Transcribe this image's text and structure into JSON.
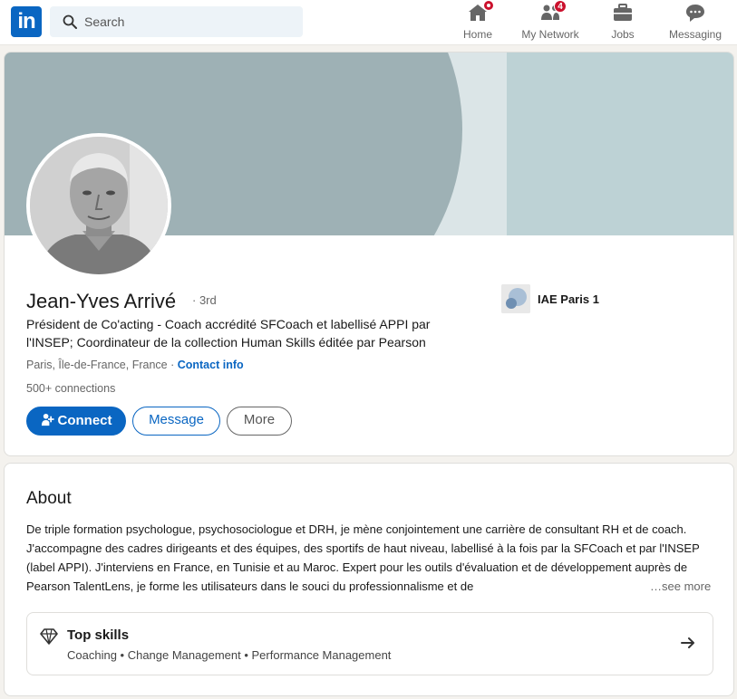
{
  "nav": {
    "logo_text": "in",
    "search_placeholder": "Search",
    "items": [
      {
        "label": "Home",
        "icon": "home-icon",
        "badge": ""
      },
      {
        "label": "My Network",
        "icon": "network-icon",
        "badge": "4"
      },
      {
        "label": "Jobs",
        "icon": "briefcase-icon",
        "badge": ""
      },
      {
        "label": "Messaging",
        "icon": "chat-icon",
        "badge": ""
      }
    ]
  },
  "profile": {
    "name": "Jean-Yves Arrivé",
    "degree": "· 3rd",
    "headline": "Président de Co'acting - Coach accrédité SFCoach et labellisé APPI par l'INSEP; Coordinateur de la collection Human Skills éditée par Pearson",
    "location": "Paris, Île-de-France, France",
    "location_sep": " · ",
    "contact_info": "Contact info",
    "connections": "500+ connections",
    "buttons": {
      "connect": "Connect",
      "message": "Message",
      "more": "More"
    },
    "education": "IAE Paris 1"
  },
  "about": {
    "title": "About",
    "text": "De triple formation psychologue, psychosociologue et DRH, je mène conjointement une carrière de consultant RH et de coach. J'accompagne des cadres dirigeants et des équipes, des sportifs de haut niveau, labellisé à la fois par la SFCoach et par l'INSEP (label APPI). J'interviens en France, en Tunisie et au Maroc. Expert pour les outils d'évaluation et de développement auprès de Pearson TalentLens, je forme les utilisateurs dans le souci du professionnalisme et de",
    "see_more": "…see more",
    "skills_title": "Top skills",
    "skills": "Coaching • Change Management • Performance Management"
  },
  "colors": {
    "brand": "#0a66c2",
    "badge": "#cb112d"
  }
}
